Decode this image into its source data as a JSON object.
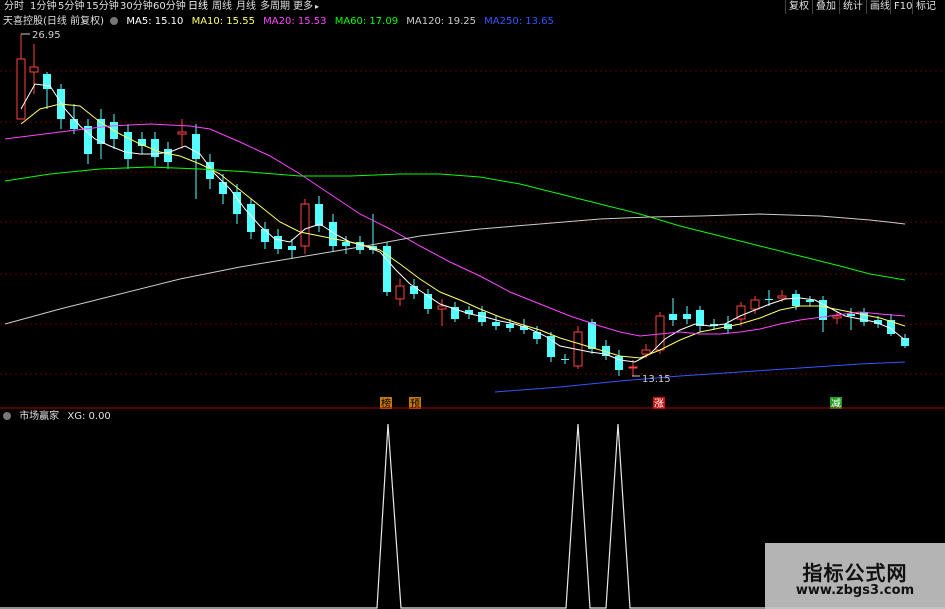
{
  "toolbar": {
    "items": [
      "分时",
      "1分钟",
      "5分钟",
      "15分钟",
      "30分钟",
      "60分钟",
      "日线",
      "周线",
      "月线",
      "多周期",
      "更多"
    ],
    "active_item": "日线",
    "right_items": [
      "复权",
      "叠加",
      "统计",
      "画线",
      "F10",
      "标记"
    ]
  },
  "main_legend": {
    "title": "天喜控股(日线 前复权)",
    "ma5": "MA5: 15.10",
    "ma10": "MA10: 15.55",
    "ma20": "MA20: 15.53",
    "ma60": "MA60: 17.09",
    "ma120": "MA120: 19.25",
    "ma250": "MA250: 13.65"
  },
  "colors": {
    "ma5": "#ffffff",
    "ma10": "#ffff66",
    "ma20": "#ff44ff",
    "ma60": "#00ff00",
    "ma120": "#cccccc",
    "ma250": "#3355ff",
    "up_candle": "#ff4040",
    "down_candle": "#54ffff",
    "grid": "#660000"
  },
  "main_chart": {
    "price_high_label": "26.95",
    "price_low_label": "13.15",
    "signal_markers": [
      "榜",
      "预",
      "涨",
      "减"
    ]
  },
  "sub_legend": {
    "title": "市场赢家",
    "xg": "XG: 0.00"
  },
  "watermark": {
    "title": "指标公式网",
    "url": "www.zbgs3.com"
  }
}
